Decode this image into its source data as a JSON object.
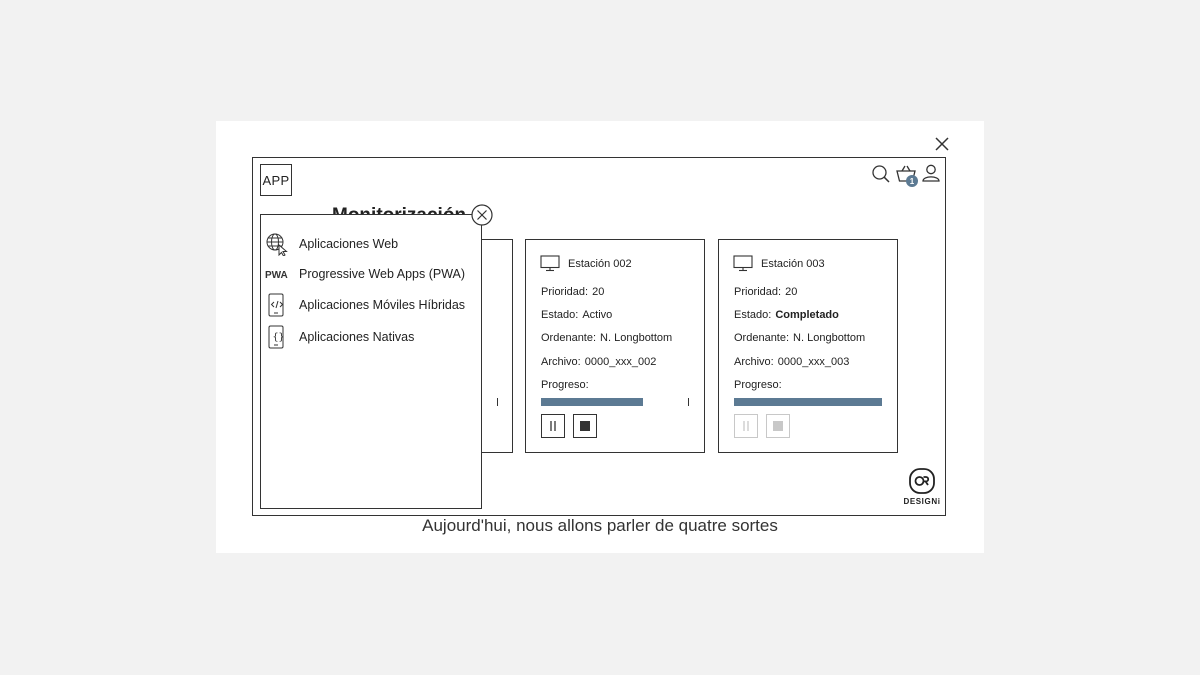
{
  "window": {
    "app_label": "APP",
    "page_title": "Monitorización"
  },
  "header": {
    "icons": [
      "search-icon",
      "cart-icon",
      "user-icon"
    ],
    "cart_count": "1"
  },
  "menu": {
    "items": [
      {
        "label": "Aplicaciones Web",
        "icon": "globe-cursor-icon"
      },
      {
        "label": "Progressive Web Apps (PWA)",
        "icon": "pwa-logo-icon"
      },
      {
        "label": "Aplicaciones Móviles Híbridas",
        "icon": "mobile-code-icon"
      },
      {
        "label": "Aplicaciones Nativas",
        "icon": "mobile-braces-icon"
      }
    ]
  },
  "cards": [
    {
      "title": "Estación 002",
      "priority_label": "Prioridad:",
      "priority": "20",
      "status_label": "Estado:",
      "status": "Activo",
      "orderer_label": "Ordenante:",
      "orderer": "N. Longbottom",
      "file_label": "Archivo:",
      "file": "0000_xxx_002",
      "progress_label": "Progreso:",
      "progress": 0.69
    },
    {
      "title": "Estación 003",
      "priority_label": "Prioridad:",
      "priority": "20",
      "status_label": "Estado:",
      "status": "Completado",
      "orderer_label": "Ordenante:",
      "orderer": "N. Longbottom",
      "file_label": "Archivo:",
      "file": "0000_xxx_003",
      "progress_label": "Progreso:",
      "progress": 1.0
    }
  ],
  "brand": {
    "text": "DESIGNi"
  },
  "caption": "Aujourd'hui, nous allons parler de quatre sortes",
  "colors": {
    "accent": "#5c7a93",
    "border": "#333333",
    "background": "#f2f2f2"
  }
}
